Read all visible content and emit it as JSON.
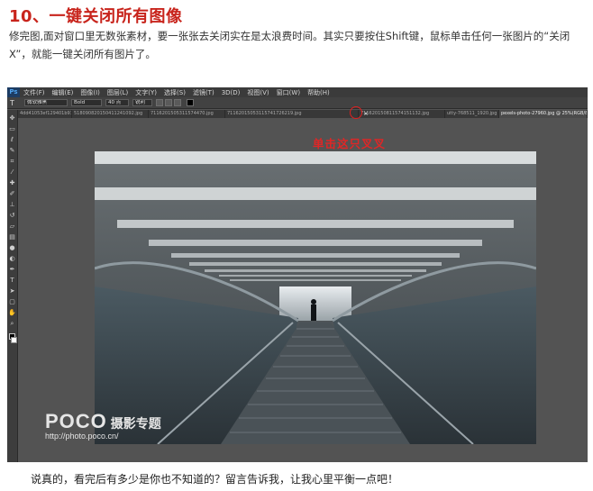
{
  "article": {
    "heading": "10、一键关闭所有图像",
    "intro": "修完图,面对窗口里无数张素材，要一张张去关闭实在是太浪费时间。其实只要按住Shift键，鼠标单击任何一张图片的“关闭X”，就能一键关闭所有图片了。",
    "footer": "说真的，看完后有多少是你也不知道的？留言告诉我，让我心里平衡一点吧！"
  },
  "photoshop": {
    "logo": "Ps",
    "menu": [
      "文件(F)",
      "编辑(E)",
      "图像(I)",
      "图层(L)",
      "文字(Y)",
      "选择(S)",
      "滤镜(T)",
      "3D(D)",
      "视图(V)",
      "窗口(W)",
      "帮助(H)"
    ],
    "options": {
      "tool_icon": "T",
      "font_family": "微软雅黑",
      "font_style": "Bold",
      "font_size": "40 点",
      "antialias": "锐利"
    },
    "tabs": [
      "4dd41053ef129401b9335.jpg",
      "518090820150411241092.jpg",
      "7116201505311574470.jpg",
      "71162015053115741726219.jpg",
      "711620150811574151132.jpg",
      "utty-768511_1920.jpg",
      "pexels-photo-27960.jpg @ 25%(RGB/8)"
    ],
    "tab_close": "×",
    "annotation": "单击这只叉叉",
    "watermark": {
      "brand": "POCO",
      "channel": "摄影专题",
      "url": "http://photo.poco.cn/"
    }
  },
  "icons": {
    "tools": [
      "move-icon",
      "marquee-icon",
      "lasso-icon",
      "quick-select-icon",
      "crop-icon",
      "eyedropper-icon",
      "healing-icon",
      "brush-icon",
      "stamp-icon",
      "history-brush-icon",
      "eraser-icon",
      "gradient-icon",
      "blur-icon",
      "dodge-icon",
      "pen-icon",
      "type-icon",
      "path-select-icon",
      "shape-icon",
      "hand-icon",
      "zoom-icon"
    ]
  },
  "colors": {
    "heading": "#c8241c",
    "annotation": "#e02626",
    "ps_background": "#535353"
  }
}
